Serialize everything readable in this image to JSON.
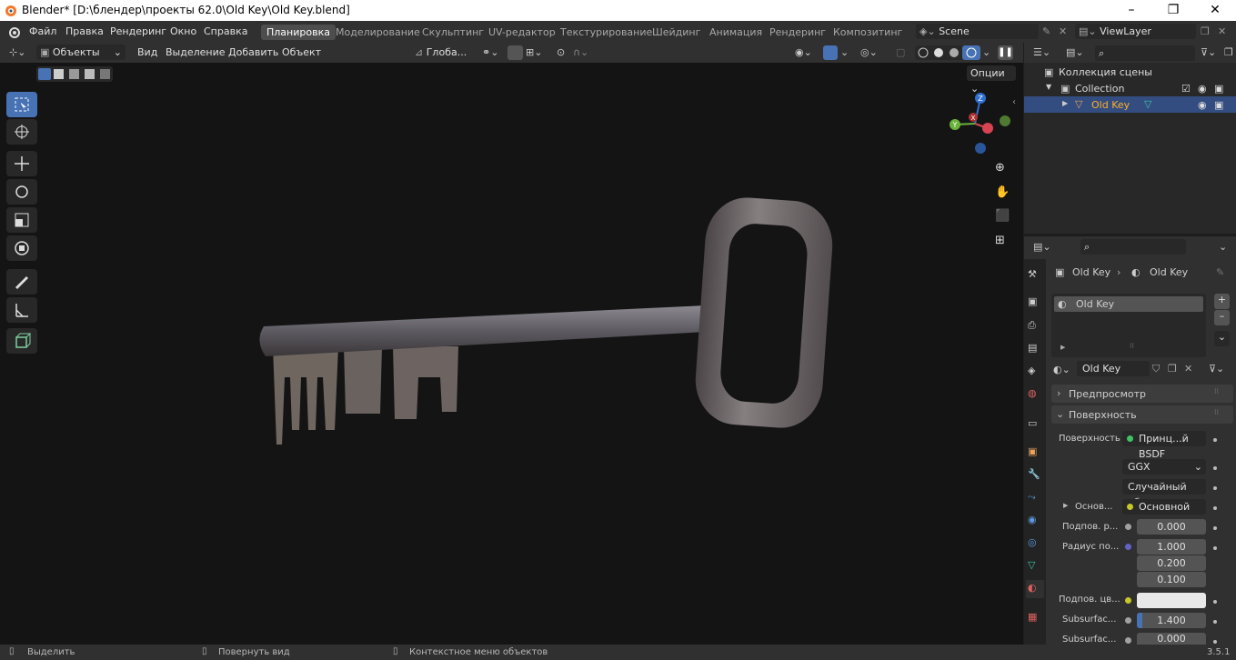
{
  "title": "Blender* [D:\\блендер\\проекты 62.0\\Old Key\\Old Key.blend]",
  "menu": [
    "Файл",
    "Правка",
    "Рендеринг",
    "Окно",
    "Справка"
  ],
  "workspaces": [
    "Планировка",
    "Моделирование",
    "Скульптинг",
    "UV-редактор",
    "Текстурирование",
    "Шейдинг",
    "Анимация",
    "Рендеринг",
    "Композитинг"
  ],
  "scene": "Scene",
  "view_layer": "ViewLayer",
  "header": {
    "mode": "Объекты",
    "view": "Вид",
    "select": "Выделение",
    "add": "Добавить",
    "object": "Объект",
    "orientation": "Глоба...",
    "options": "Опции"
  },
  "gizmo": {
    "z": "Z",
    "y": "Y",
    "x": "X"
  },
  "outliner": {
    "scene_collection": "Коллекция сцены",
    "collection": "Collection",
    "object": "Old Key"
  },
  "props": {
    "breadcrumb_obj": "Old Key",
    "breadcrumb_mat": "Old Key",
    "slot": "Old Key",
    "material": "Old Key",
    "preview": "Предпросмотр",
    "surface_section": "Поверхность",
    "surface_label": "Поверхность",
    "surface_value": "Принц...й BSDF",
    "distribution": "GGX",
    "subsurface_method": "Случайный об...",
    "base_label": "Основ...",
    "base_value": "Основной цвет",
    "sub_label": "Подпов. р...",
    "sub_value": "0.000",
    "radius_label": "Радиус по...",
    "radius": [
      "1.000",
      "0.200",
      "0.100"
    ],
    "sub_color_label": "Подпов. цв...",
    "ior_label": "Subsurfac...",
    "ior_value": "1.400",
    "aniso_label": "Subsurfac...",
    "aniso_value": "0.000"
  },
  "status": {
    "select": "Выделить",
    "rotate": "Повернуть вид",
    "context": "Контекстное меню объектов",
    "version": "3.5.1"
  }
}
